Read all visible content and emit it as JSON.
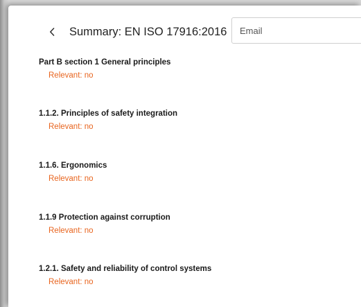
{
  "header": {
    "back_icon": "chevron-left-icon",
    "title": "Summary: EN ISO 17916:2016",
    "email_placeholder": "Email"
  },
  "colors": {
    "status": "#e8641e",
    "title_text": "#1a1a1a"
  },
  "items": [
    {
      "title": "Part B section 1 General principles",
      "status": "Relevant: no"
    },
    {
      "title": "1.1.2. Principles of safety integration",
      "status": "Relevant: no"
    },
    {
      "title": "1.1.6. Ergonomics",
      "status": "Relevant: no"
    },
    {
      "title": "1.1.9 Protection against corruption",
      "status": "Relevant: no"
    },
    {
      "title": "1.2.1. Safety and reliability of control systems",
      "status": "Relevant: no"
    }
  ]
}
